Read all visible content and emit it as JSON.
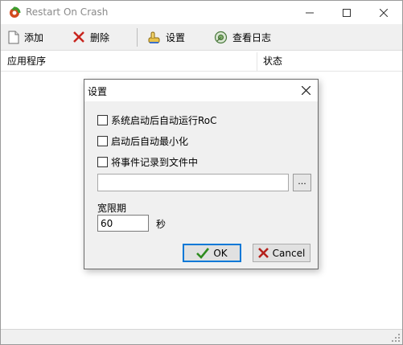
{
  "window": {
    "title": "Restart On Crash",
    "icon": "restart-app-icon"
  },
  "toolbar": {
    "add_label": "添加",
    "delete_label": "删除",
    "settings_label": "设置",
    "view_log_label": "查看日志"
  },
  "list": {
    "columns": [
      "应用程序",
      "状态"
    ],
    "rows": []
  },
  "dialog": {
    "title": "设置",
    "autorun_label": "系统启动后自动运行RoC",
    "autorun_checked": false,
    "minimize_label": "启动后自动最小化",
    "minimize_checked": false,
    "log_label": "将事件记录到文件中",
    "log_checked": false,
    "log_path_value": "",
    "browse_label": "...",
    "grace_label": "宽限期",
    "grace_value": "60",
    "grace_unit": "秒",
    "ok_label": "OK",
    "cancel_label": "Cancel"
  },
  "colors": {
    "ok_check": "#2e8b1e",
    "cancel_x": "#b5211c",
    "delete_x": "#c8251e",
    "focus_border": "#0078d7"
  }
}
